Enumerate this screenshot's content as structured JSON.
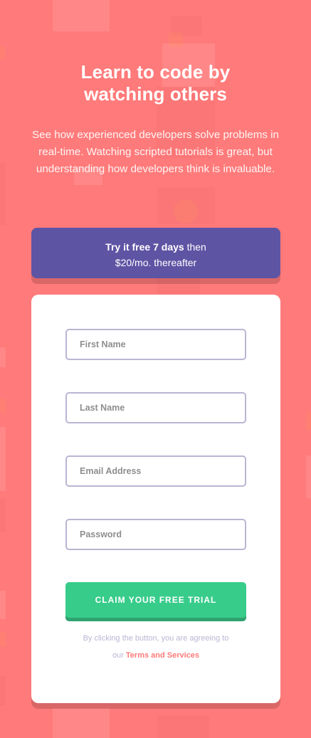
{
  "hero": {
    "title_line1": "Learn to code by",
    "title_line2": "watching others",
    "subtitle": "See how experienced developers solve problems in real-time. Watching scripted tutorials is great, but understanding how developers think is invaluable."
  },
  "promo": {
    "bold_text": "Try it free 7 days",
    "then_text": " then",
    "price_text": "$20/mo. thereafter"
  },
  "form": {
    "first_name_placeholder": "First Name",
    "last_name_placeholder": "Last Name",
    "email_placeholder": "Email Address",
    "password_placeholder": "Password",
    "submit_label": "CLAIM YOUR FREE TRIAL",
    "terms_prefix": "By clicking the button, you are agreeing to",
    "terms_prefix2": "our ",
    "terms_link": "Terms and Services"
  },
  "colors": {
    "background": "#ff7a7a",
    "promo_background": "#5e54a4",
    "cta_green": "#38cc8b",
    "border_lavender": "#b9b6d3"
  }
}
